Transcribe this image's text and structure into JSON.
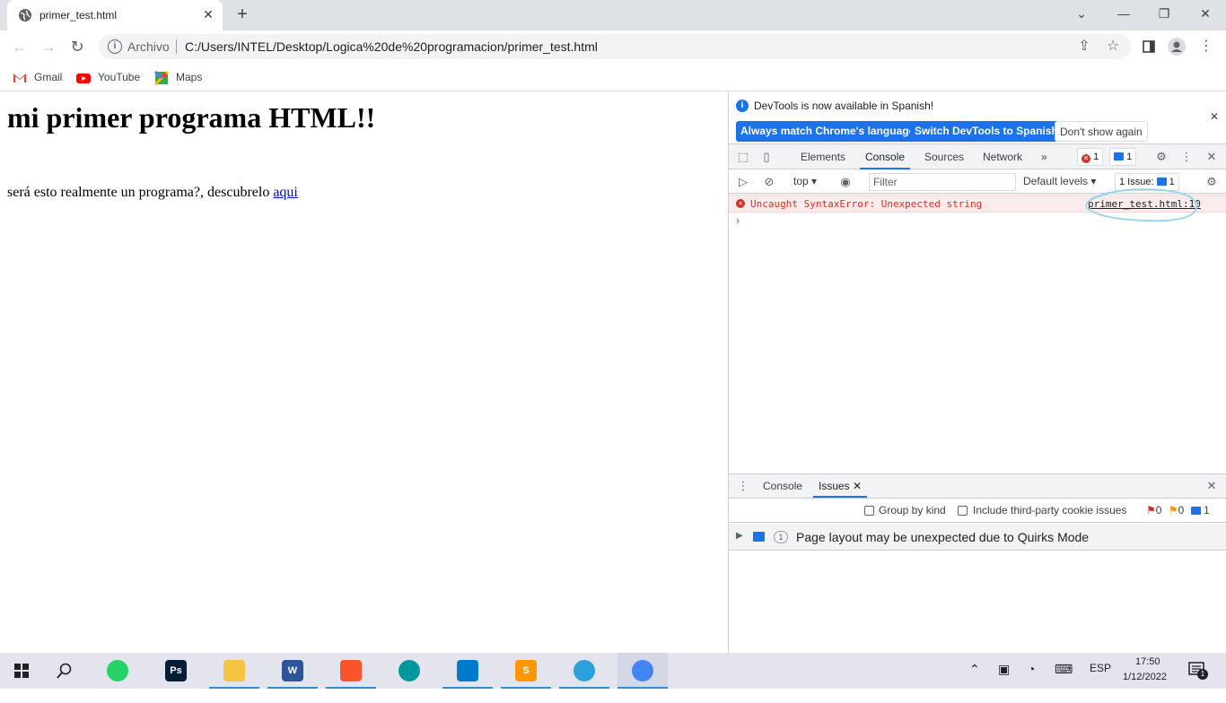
{
  "browser": {
    "tab_title": "primer_test.html",
    "address_scheme": "Archivo",
    "url": "C:/Users/INTEL/Desktop/Logica%20de%20programacion/primer_test.html",
    "bookmarks": [
      {
        "label": "Gmail",
        "icon": "gmail-icon"
      },
      {
        "label": "YouTube",
        "icon": "youtube-icon"
      },
      {
        "label": "Maps",
        "icon": "maps-icon"
      }
    ]
  },
  "page": {
    "heading": "mi primer programa HTML!!",
    "paragraph": "será esto realmente un programa?, descubrelo",
    "link_text": "aqui"
  },
  "devtools": {
    "banner": {
      "text": "DevTools is now available in Spanish!",
      "btn_match": "Always match Chrome's language",
      "btn_switch": "Switch DevTools to Spanish",
      "btn_dismiss": "Don't show again"
    },
    "tabs": [
      "Elements",
      "Console",
      "Sources",
      "Network"
    ],
    "more_tabs": "»",
    "error_count": "1",
    "message_count": "1",
    "context": "top",
    "filter_placeholder": "Filter",
    "levels": "Default levels",
    "issues_label": "1 Issue:",
    "issues_count": "1",
    "console_error": "Uncaught SyntaxError: Unexpected string",
    "console_error_source": "primer_test.html:10",
    "drawer": {
      "tabs": [
        "Console",
        "Issues"
      ],
      "group_by_kind": "Group by kind",
      "third_party": "Include third-party cookie issues",
      "count_errors": "0",
      "count_warnings": "0",
      "count_info": "1",
      "issue_count": "1",
      "issue_text": "Page layout may be unexpected due to Quirks Mode"
    }
  },
  "taskbar": {
    "apps": [
      {
        "name": "whatsapp",
        "label": "",
        "color": "#25d366"
      },
      {
        "name": "photoshop",
        "label": "Ps",
        "color": "#001e36"
      },
      {
        "name": "file-explorer",
        "label": "",
        "color": "#f5c342"
      },
      {
        "name": "word",
        "label": "W",
        "color": "#2b579a"
      },
      {
        "name": "brave",
        "label": "",
        "color": "#fb542b"
      },
      {
        "name": "arduino",
        "label": "",
        "color": "#00979d"
      },
      {
        "name": "vscode",
        "label": "",
        "color": "#007acc"
      },
      {
        "name": "sublime",
        "label": "S",
        "color": "#ff9800"
      },
      {
        "name": "telegram",
        "label": "",
        "color": "#2aa1da"
      },
      {
        "name": "chrome",
        "label": "",
        "color": "#4285f4"
      }
    ],
    "language": "ESP",
    "time": "17:50",
    "date": "1/12/2022",
    "notification_count": "1"
  }
}
